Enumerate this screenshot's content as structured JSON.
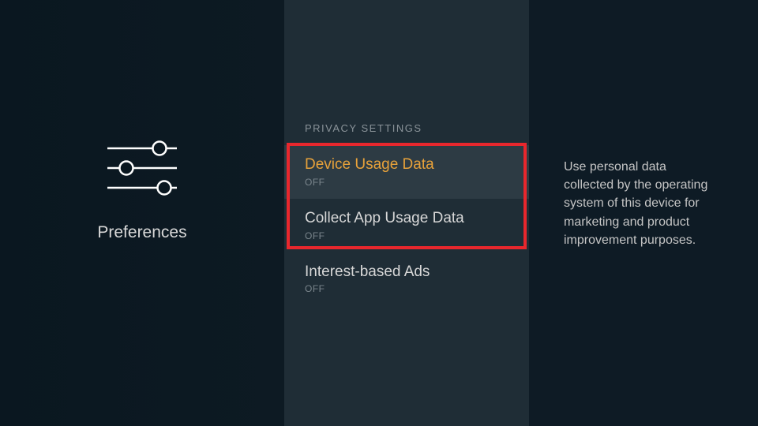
{
  "left": {
    "label": "Preferences"
  },
  "section": {
    "header": "PRIVACY SETTINGS"
  },
  "items": [
    {
      "title": "Device Usage Data",
      "status": "OFF"
    },
    {
      "title": "Collect App Usage Data",
      "status": "OFF"
    },
    {
      "title": "Interest-based Ads",
      "status": "OFF"
    }
  ],
  "description": "Use personal data collected by the operating system of this device for marketing and product improvement purposes."
}
